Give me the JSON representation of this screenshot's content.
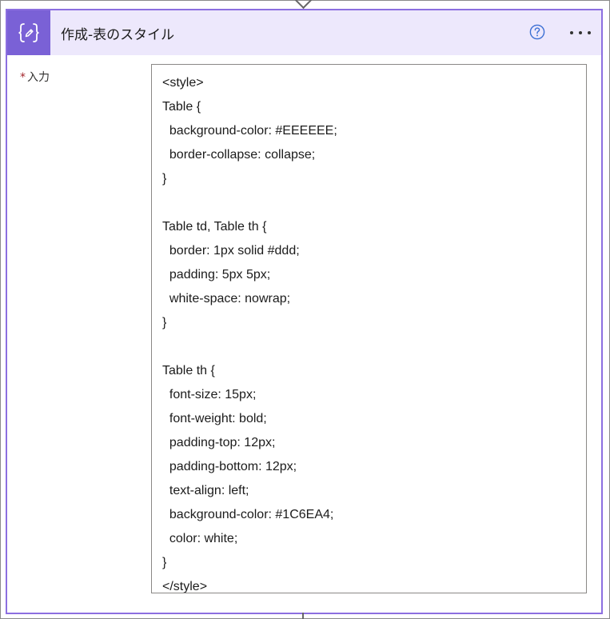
{
  "action": {
    "title": "作成-表のスタイル",
    "icon": "curly-braces-edit-icon",
    "help_icon": "question-circle-icon",
    "more_icon": "more-dots-icon",
    "accent_color": "#7a61d6",
    "header_bg": "#ede8fc",
    "border_color": "#8c6fe0"
  },
  "field": {
    "required_marker": "*",
    "label": "入力",
    "value_lines": [
      "<style>",
      "Table {",
      "  background-color: #EEEEEE;",
      "  border-collapse: collapse;",
      "}",
      "",
      "Table td, Table th {",
      "  border: 1px solid #ddd;",
      "  padding: 5px 5px;",
      "  white-space: nowrap;",
      "}",
      "",
      "Table th {",
      "  font-size: 15px;",
      "  font-weight: bold;",
      "  padding-top: 12px;",
      "  padding-bottom: 12px;",
      "  text-align: left;",
      "  background-color: #1C6EA4;",
      "  color: white;",
      "}",
      "</style>"
    ]
  }
}
